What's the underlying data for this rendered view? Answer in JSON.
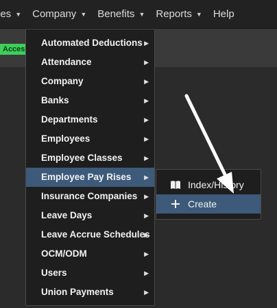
{
  "navbar": {
    "items": [
      {
        "label": "ges",
        "has_dropdown": true
      },
      {
        "label": "Company",
        "has_dropdown": true
      },
      {
        "label": "Benefits",
        "has_dropdown": true
      },
      {
        "label": "Reports",
        "has_dropdown": true
      },
      {
        "label": "Help",
        "has_dropdown": false
      }
    ]
  },
  "badge": {
    "label": "Access",
    "color": "#3ecf5b"
  },
  "menu": {
    "items": [
      {
        "label": "Automated Deductions"
      },
      {
        "label": "Attendance"
      },
      {
        "label": "Company"
      },
      {
        "label": "Banks"
      },
      {
        "label": "Departments"
      },
      {
        "label": "Employees"
      },
      {
        "label": "Employee Classes"
      },
      {
        "label": "Employee Pay Rises"
      },
      {
        "label": "Insurance Companies"
      },
      {
        "label": "Leave Days"
      },
      {
        "label": "Leave Accrue Schedules"
      },
      {
        "label": "OCM/ODM"
      },
      {
        "label": "Users"
      },
      {
        "label": "Union Payments"
      }
    ],
    "active_index": 7,
    "highlight_color": "#3d5a7a"
  },
  "submenu": {
    "items": [
      {
        "label": "Index/History",
        "icon": "book-icon"
      },
      {
        "label": "Create",
        "icon": "plus-icon"
      }
    ],
    "active_index": 1
  }
}
